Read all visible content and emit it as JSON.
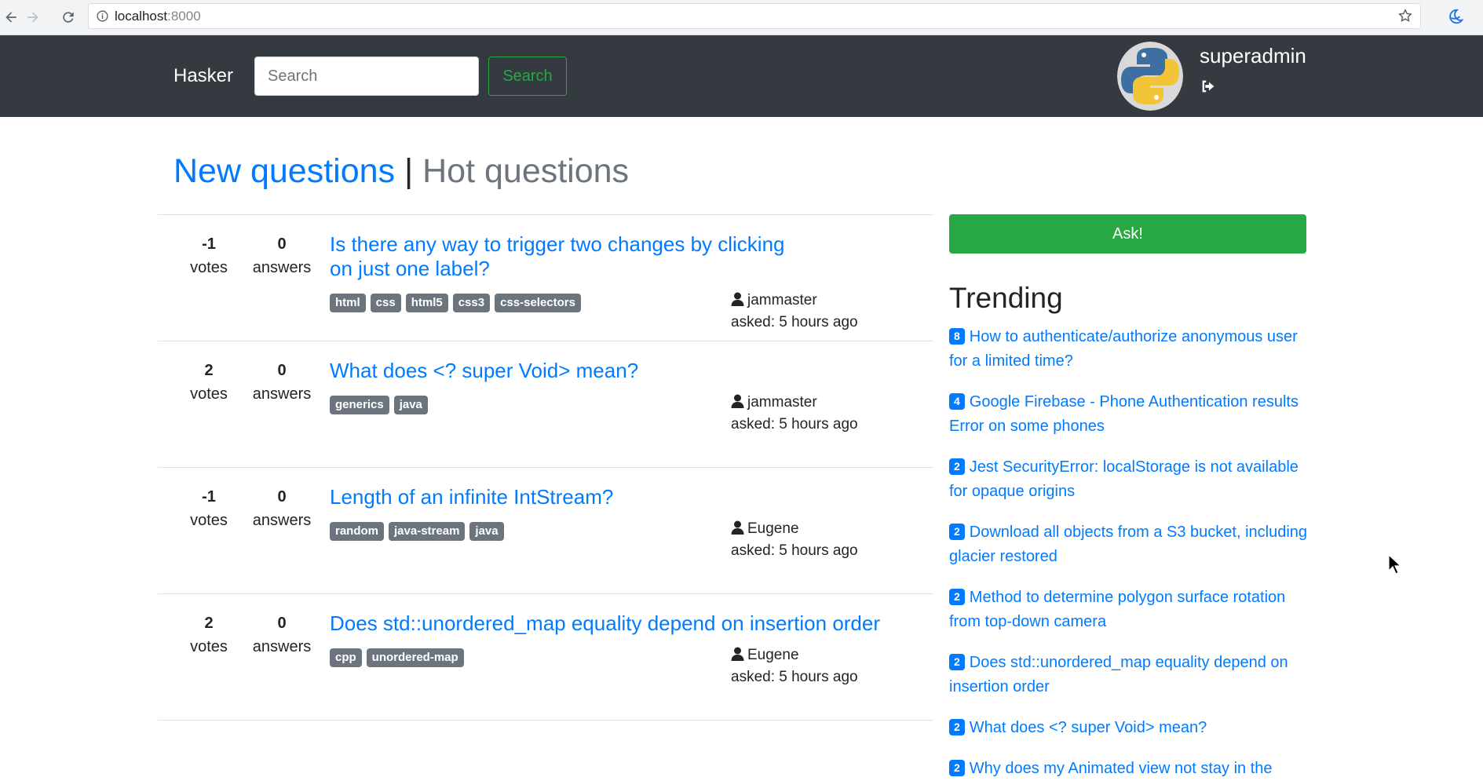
{
  "browser": {
    "url_host": "localhost",
    "url_port": ":8000"
  },
  "navbar": {
    "brand": "Hasker",
    "search_placeholder": "Search",
    "search_button": "Search",
    "username": "superadmin"
  },
  "heading": {
    "new": "New questions",
    "separator": " | ",
    "hot": "Hot questions"
  },
  "questions": [
    {
      "votes": "-1",
      "votes_label": "votes",
      "answers": "0",
      "answers_label": "answers",
      "title": "Is there any way to trigger two changes by clicking on just one label?",
      "tags": [
        "html",
        "css",
        "html5",
        "css3",
        "css-selectors"
      ],
      "author": "jammaster",
      "asked": "asked: 5 hours ago"
    },
    {
      "votes": "2",
      "votes_label": "votes",
      "answers": "0",
      "answers_label": "answers",
      "title": "What does <? super Void> mean?",
      "tags": [
        "generics",
        "java"
      ],
      "author": "jammaster",
      "asked": "asked: 5 hours ago"
    },
    {
      "votes": "-1",
      "votes_label": "votes",
      "answers": "0",
      "answers_label": "answers",
      "title": "Length of an infinite IntStream?",
      "tags": [
        "random",
        "java-stream",
        "java"
      ],
      "author": "Eugene",
      "asked": "asked: 5 hours ago"
    },
    {
      "votes": "2",
      "votes_label": "votes",
      "answers": "0",
      "answers_label": "answers",
      "title": "Does std::unordered_map equality depend on insertion order",
      "tags": [
        "cpp",
        "unordered-map"
      ],
      "author": "Eugene",
      "asked": "asked: 5 hours ago"
    }
  ],
  "sidebar": {
    "ask_button": "Ask!",
    "trending_title": "Trending",
    "trending": [
      {
        "count": "8",
        "title": "How to authenticate/authorize anonymous user for a limited time?"
      },
      {
        "count": "4",
        "title": "Google Firebase - Phone Authentication results Error on some phones"
      },
      {
        "count": "2",
        "title": "Jest SecurityError: localStorage is not available for opaque origins"
      },
      {
        "count": "2",
        "title": "Download all objects from a S3 bucket, including glacier restored"
      },
      {
        "count": "2",
        "title": "Method to determine polygon surface rotation from top-down camera"
      },
      {
        "count": "2",
        "title": "Does std::unordered_map equality depend on insertion order"
      },
      {
        "count": "2",
        "title": "What does <? super Void> mean?"
      },
      {
        "count": "2",
        "title": "Why does my Animated view not stay in the"
      }
    ]
  },
  "colors": {
    "navbar_bg": "#343a40",
    "primary": "#007bff",
    "success": "#28a745",
    "tag_bg": "#6c757d"
  }
}
